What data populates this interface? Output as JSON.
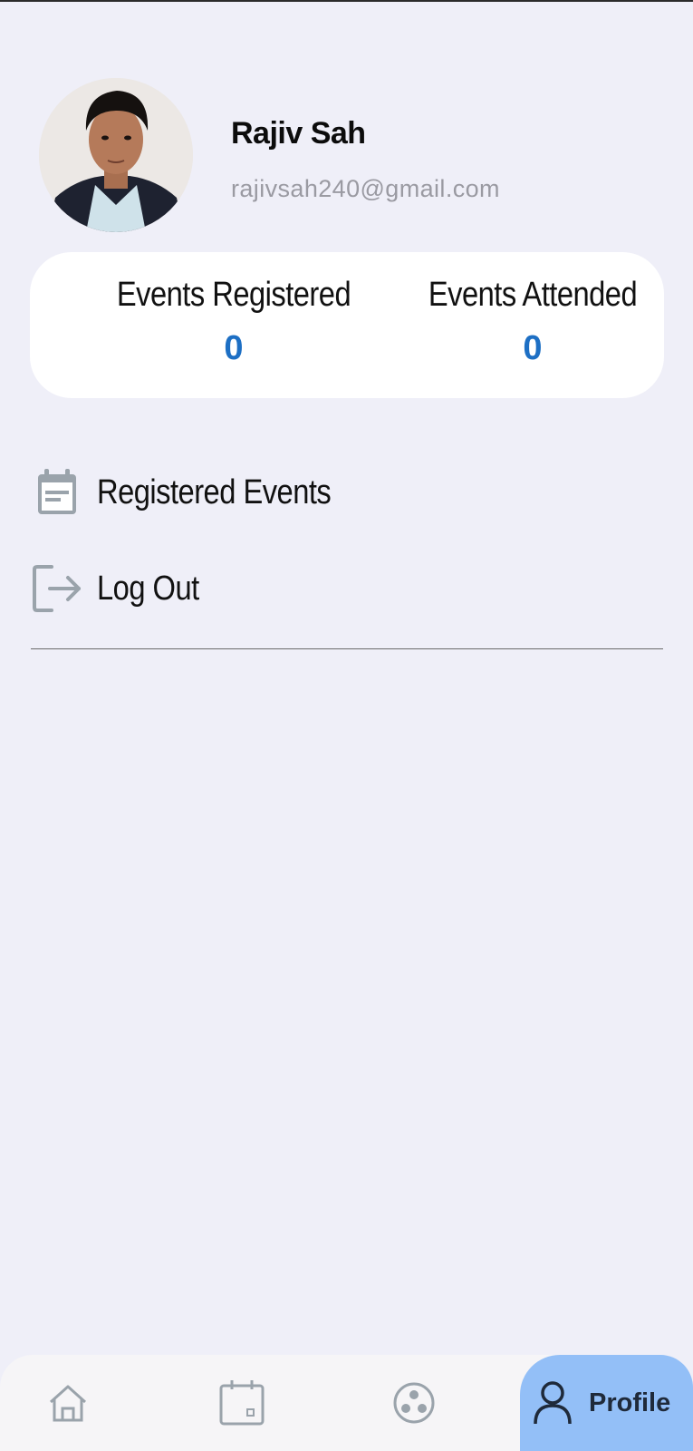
{
  "profile": {
    "name": "Rajiv Sah",
    "email": "rajivsah240@gmail.com",
    "avatar_icon": "user-photo"
  },
  "stats": {
    "registered_label": "Events Registered",
    "registered_value": "0",
    "attended_label": "Events Attended",
    "attended_value": "0",
    "value_color": "#1d6fc4"
  },
  "menu": {
    "items": [
      {
        "label": "Registered Events",
        "icon": "calendar-list-icon"
      },
      {
        "label": "Log Out",
        "icon": "logout-icon"
      }
    ]
  },
  "bottom_nav": {
    "items": [
      {
        "name": "home",
        "icon": "home-icon"
      },
      {
        "name": "calendar",
        "icon": "calendar-icon"
      },
      {
        "name": "community",
        "icon": "community-icon"
      },
      {
        "name": "profile",
        "icon": "person-icon",
        "label": "Profile",
        "active": true
      }
    ],
    "active_color": "#93bff7"
  }
}
